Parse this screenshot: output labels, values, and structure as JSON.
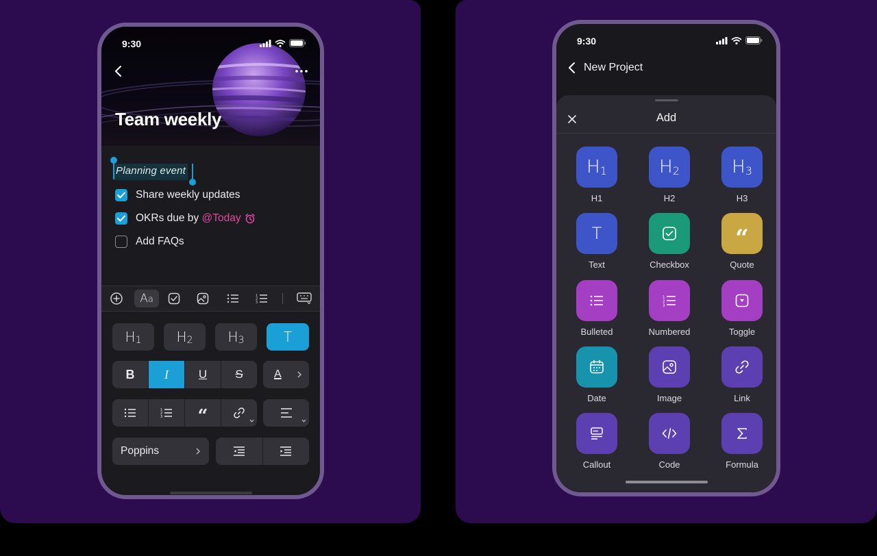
{
  "colors": {
    "background": "#2c0c4f",
    "phone_frame": "#705891",
    "accent": "#1aa0d6",
    "mention": "#e24aa0"
  },
  "left_phone": {
    "status_time": "9:30",
    "page_title": "Team weekly",
    "selected_text": "Planning event",
    "todos": [
      {
        "text": "Share weekly updates",
        "checked": true
      },
      {
        "text": "OKRs due by ",
        "mention": "@Today",
        "checked": true,
        "icon": "alarm-icon"
      },
      {
        "text": "Add FAQs",
        "checked": false
      }
    ],
    "toolbar_icons": [
      "add-icon",
      "text-style-icon",
      "checkbox-icon",
      "image-icon",
      "bullet-list-icon",
      "numbered-list-icon",
      "keyboard-dismiss-icon"
    ],
    "headings": [
      "H1",
      "H2",
      "H3",
      "T"
    ],
    "font_selector": {
      "label": "Poppins"
    }
  },
  "right_phone": {
    "status_time": "9:30",
    "nav_title": "New Project",
    "sheet_title": "Add",
    "blocks": [
      {
        "label": "H1",
        "icon": "h1-icon",
        "color": "#3d55c9"
      },
      {
        "label": "H2",
        "icon": "h2-icon",
        "color": "#3d55c9"
      },
      {
        "label": "H3",
        "icon": "h3-icon",
        "color": "#3d55c9"
      },
      {
        "label": "Text",
        "icon": "text-icon",
        "color": "#3d55c9"
      },
      {
        "label": "Checkbox",
        "icon": "checkbox-icon",
        "color": "#1a9a79"
      },
      {
        "label": "Quote",
        "icon": "quote-icon",
        "color": "#c9a844"
      },
      {
        "label": "Bulleted",
        "icon": "bullet-list-icon",
        "color": "#a43fc4"
      },
      {
        "label": "Numbered",
        "icon": "numbered-list-icon",
        "color": "#a43fc4"
      },
      {
        "label": "Toggle",
        "icon": "toggle-icon",
        "color": "#a43fc4"
      },
      {
        "label": "Date",
        "icon": "calendar-icon",
        "color": "#1793ad"
      },
      {
        "label": "Image",
        "icon": "image-icon",
        "color": "#5c3fb0"
      },
      {
        "label": "Link",
        "icon": "link-icon",
        "color": "#5c3fb0"
      },
      {
        "label": "Callout",
        "icon": "callout-icon",
        "color": "#5c3fb0"
      },
      {
        "label": "Code",
        "icon": "code-icon",
        "color": "#5c3fb0"
      },
      {
        "label": "Formula",
        "icon": "sigma-icon",
        "color": "#5c3fb0"
      }
    ]
  }
}
